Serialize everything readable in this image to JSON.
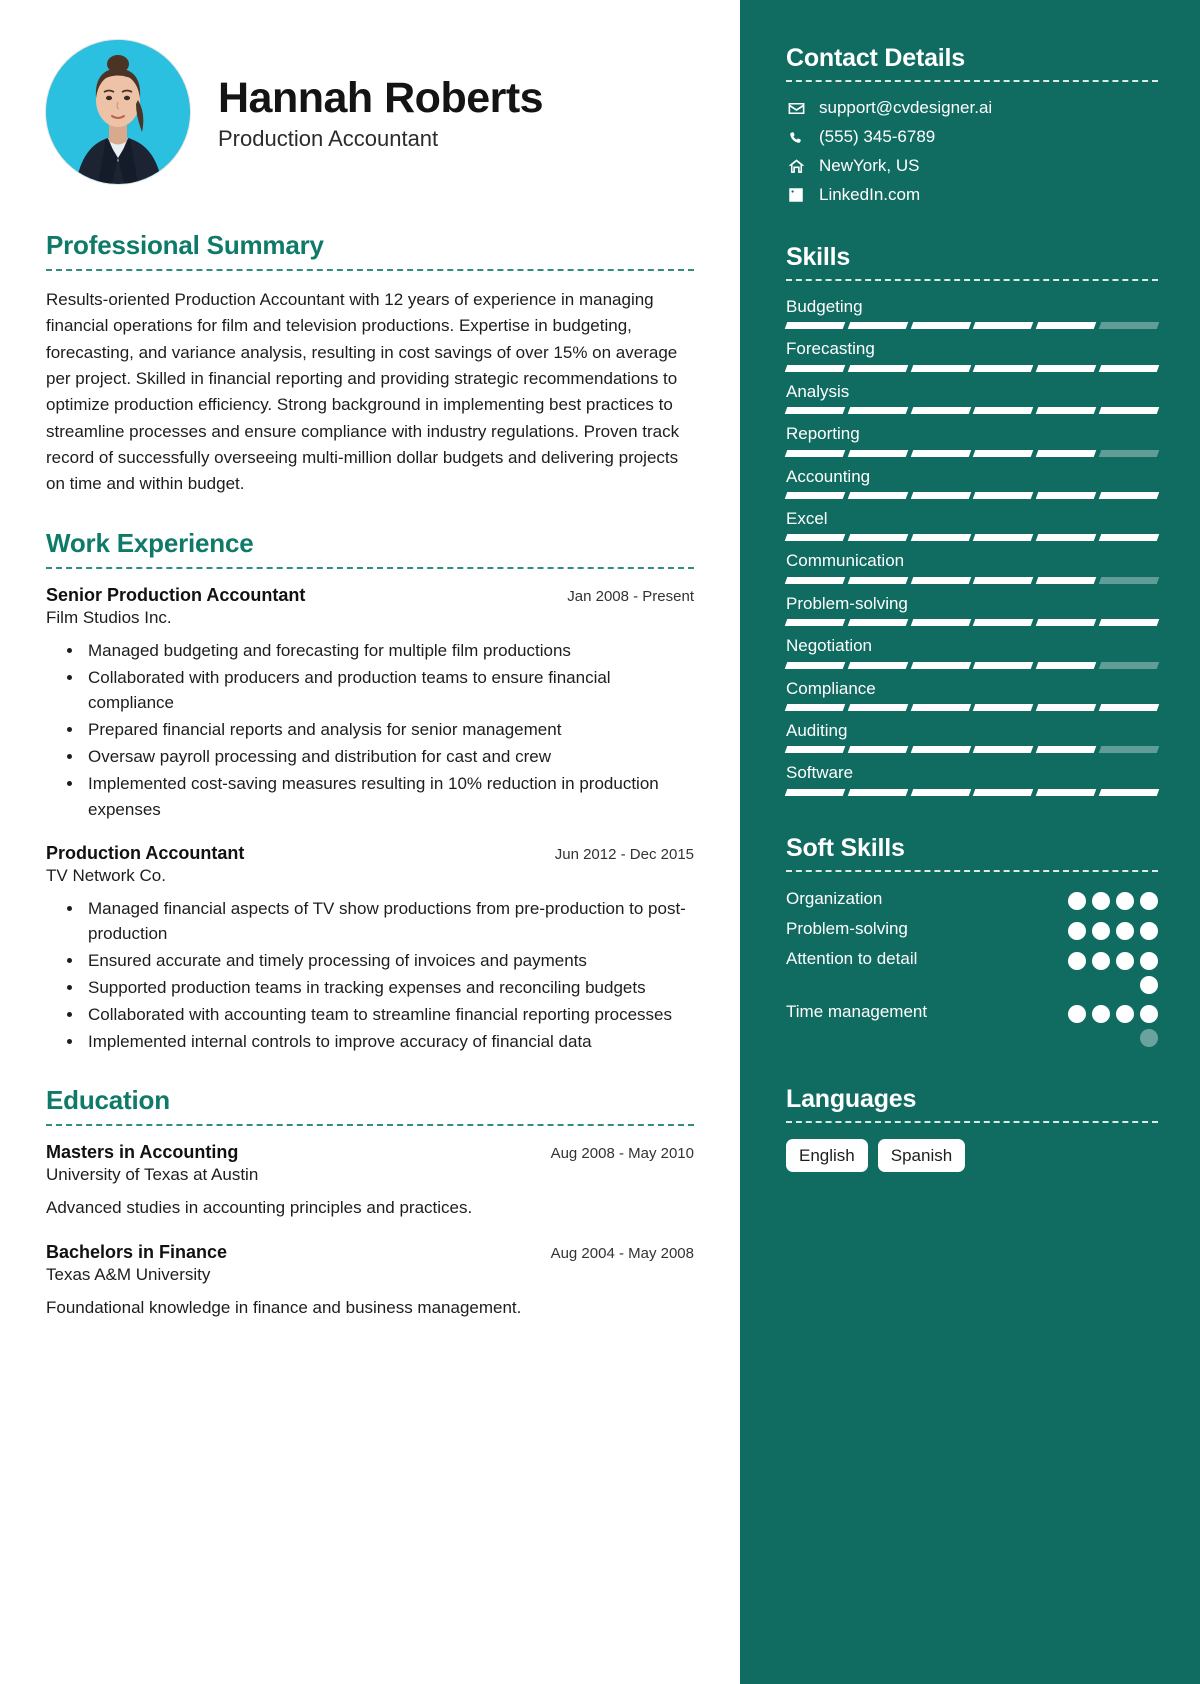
{
  "profile": {
    "name": "Hannah Roberts",
    "title": "Production Accountant",
    "avatar_alt": "portrait-photo"
  },
  "accent_color": "#107a69",
  "sidebar_color": "#106b61",
  "sections": {
    "summary_title": "Professional Summary",
    "experience_title": "Work Experience",
    "education_title": "Education"
  },
  "summary": {
    "text": "Results-oriented Production Accountant with 12 years of experience in managing financial operations for film and television productions. Expertise in budgeting, forecasting, and variance analysis, resulting in cost savings of over 15% on average per project. Skilled in financial reporting and providing strategic recommendations to optimize production efficiency. Strong background in implementing best practices to streamline processes and ensure compliance with industry regulations. Proven track record of successfully overseeing multi-million dollar budgets and delivering projects on time and within budget."
  },
  "experience": [
    {
      "role": "Senior Production Accountant",
      "date": "Jan 2008 - Present",
      "company": "Film Studios Inc.",
      "bullets": [
        "Managed budgeting and forecasting for multiple film productions",
        "Collaborated with producers and production teams to ensure financial compliance",
        "Prepared financial reports and analysis for senior management",
        "Oversaw payroll processing and distribution for cast and crew",
        "Implemented cost-saving measures resulting in 10% reduction in production expenses"
      ]
    },
    {
      "role": "Production Accountant",
      "date": "Jun 2012 - Dec 2015",
      "company": "TV Network Co.",
      "bullets": [
        "Managed financial aspects of TV show productions from pre-production to post-production",
        "Ensured accurate and timely processing of invoices and payments",
        "Supported production teams in tracking expenses and reconciling budgets",
        "Collaborated with accounting team to streamline financial reporting processes",
        "Implemented internal controls to improve accuracy of financial data"
      ]
    }
  ],
  "education": [
    {
      "degree": "Masters in Accounting",
      "date": "Aug 2008 - May 2010",
      "school": "University of Texas at Austin",
      "description": "Advanced studies in accounting principles and practices."
    },
    {
      "degree": "Bachelors in Finance",
      "date": "Aug 2004 - May 2008",
      "school": "Texas A&M University",
      "description": "Foundational knowledge in finance and business management."
    }
  ],
  "sidebar": {
    "contact_title": "Contact Details",
    "contacts": [
      {
        "icon": "envelope-icon",
        "value": "support@cvdesigner.ai"
      },
      {
        "icon": "phone-icon",
        "value": "(555) 345-6789"
      },
      {
        "icon": "home-icon",
        "value": "NewYork, US"
      },
      {
        "icon": "linkedin-icon",
        "value": "LinkedIn.com"
      }
    ],
    "skills_title": "Skills",
    "skills": [
      {
        "name": "Budgeting",
        "segments": 6,
        "filled": 5
      },
      {
        "name": "Forecasting",
        "segments": 6,
        "filled": 6
      },
      {
        "name": "Analysis",
        "segments": 6,
        "filled": 6
      },
      {
        "name": "Reporting",
        "segments": 6,
        "filled": 5
      },
      {
        "name": "Accounting",
        "segments": 6,
        "filled": 6
      },
      {
        "name": "Excel",
        "segments": 6,
        "filled": 6
      },
      {
        "name": "Communication",
        "segments": 6,
        "filled": 5
      },
      {
        "name": "Problem-solving",
        "segments": 6,
        "filled": 6
      },
      {
        "name": "Negotiation",
        "segments": 6,
        "filled": 5
      },
      {
        "name": "Compliance",
        "segments": 6,
        "filled": 6
      },
      {
        "name": "Auditing",
        "segments": 6,
        "filled": 5
      },
      {
        "name": "Software",
        "segments": 6,
        "filled": 6
      }
    ],
    "soft_skills_title": "Soft Skills",
    "soft_skills": [
      {
        "name": "Organization",
        "dots": 4,
        "filled": 4
      },
      {
        "name": "Problem-solving",
        "dots": 4,
        "filled": 4
      },
      {
        "name": "Attention to detail",
        "dots": 5,
        "filled": 5
      },
      {
        "name": "Time management",
        "dots": 5,
        "filled": 4
      }
    ],
    "languages_title": "Languages",
    "languages": [
      "English",
      "Spanish"
    ]
  }
}
